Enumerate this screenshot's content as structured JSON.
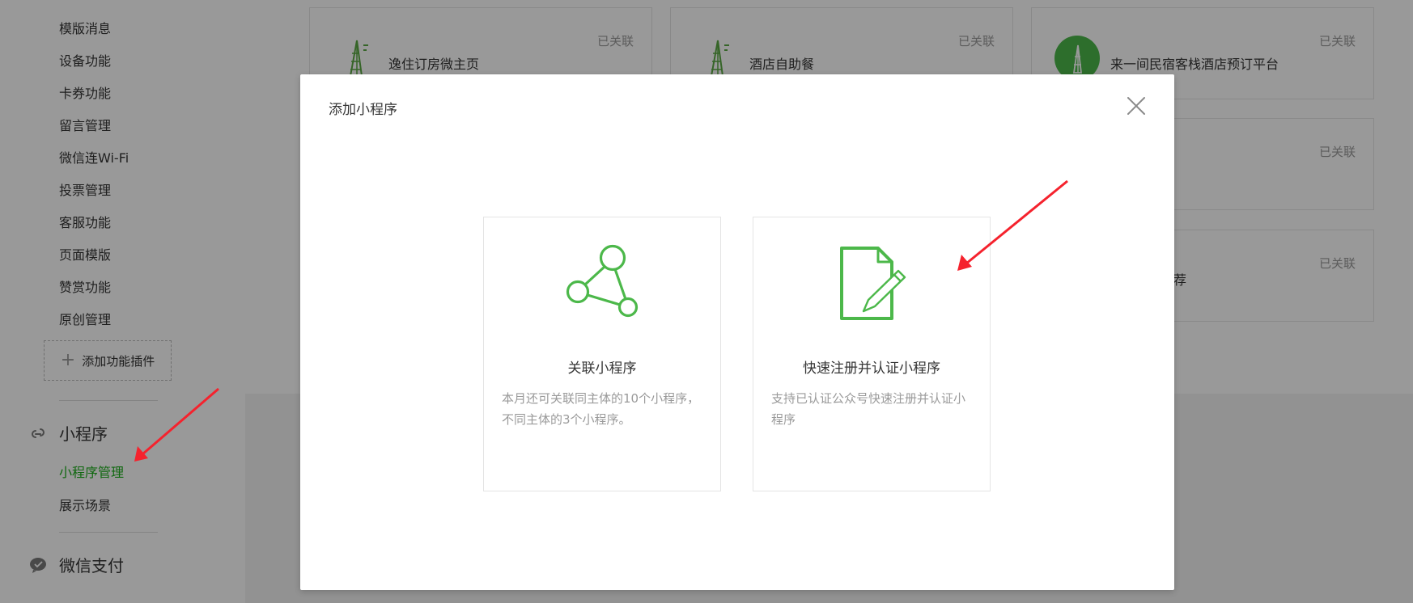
{
  "sidebar": {
    "menu_items": [
      "模版消息",
      "设备功能",
      "卡券功能",
      "留言管理",
      "微信连Wi-Fi",
      "投票管理",
      "客服功能",
      "页面模版",
      "赞赏功能",
      "原创管理"
    ],
    "add_plugin_label": "添加功能插件",
    "mini_program": {
      "heading": "小程序",
      "items": [
        "小程序管理",
        "展示场景"
      ],
      "active_index": 0
    },
    "wechat_pay": {
      "heading": "微信支付"
    }
  },
  "app_cards": [
    {
      "name": "逸住订房微主页",
      "status": "已关联"
    },
    {
      "name": "酒店自助餐",
      "status": "已关联"
    },
    {
      "name": "来一间民宿客栈酒店预订平台",
      "status": "已关联"
    },
    {
      "name": "",
      "status": "已关联"
    },
    {
      "name": "荐",
      "status": "已关联"
    }
  ],
  "dialog": {
    "title": "添加小程序",
    "options": [
      {
        "title": "关联小程序",
        "description": "本月还可关联同主体的10个小程序，不同主体的3个小程序。",
        "icon": "link-nodes-icon"
      },
      {
        "title": "快速注册并认证小程序",
        "description": "支持已认证公众号快速注册并认证小程序",
        "icon": "document-edit-icon"
      }
    ]
  },
  "colors": {
    "brand_green": "#1aad19",
    "icon_green": "#4cb84a",
    "annotation_red": "#f5222d"
  }
}
